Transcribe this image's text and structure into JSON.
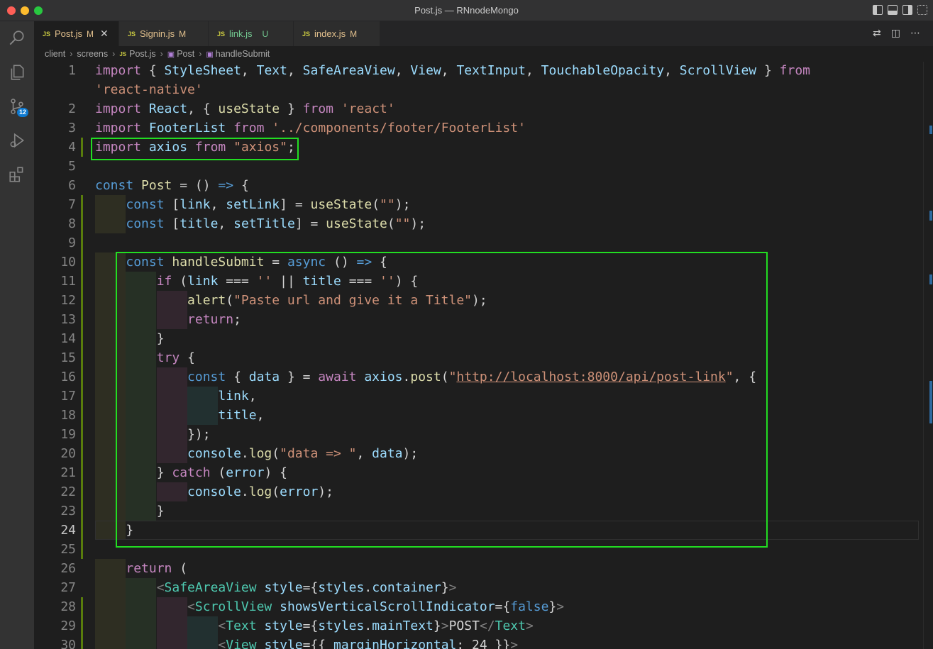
{
  "window": {
    "title": "Post.js — RNnodeMongo"
  },
  "activity_bar": {
    "items": [
      {
        "name": "explorer",
        "icon": "files-icon"
      },
      {
        "name": "search",
        "icon": "search-icon"
      },
      {
        "name": "source-control",
        "icon": "source-control-icon",
        "badge": "12"
      },
      {
        "name": "run-debug",
        "icon": "run-debug-icon"
      },
      {
        "name": "extensions",
        "icon": "extensions-icon"
      }
    ]
  },
  "tabs": [
    {
      "label": "Post.js",
      "status": "M",
      "active": true
    },
    {
      "label": "Signin.js",
      "status": "M",
      "active": false
    },
    {
      "label": "link.js",
      "status": "U",
      "active": false
    },
    {
      "label": "index.js",
      "status": "M",
      "active": false
    }
  ],
  "tab_file_type": "JS",
  "breadcrumb": [
    "client",
    "screens",
    "Post.js",
    "Post",
    "handleSubmit"
  ],
  "editor": {
    "current_line": 24,
    "lines": [
      {
        "n": "1",
        "t": "import { StyleSheet, Text, SafeAreaView, View, TextInput, TouchableOpacity, ScrollView } from"
      },
      {
        "n": "",
        "t": "'react-native'"
      },
      {
        "n": "2",
        "t": "import React, { useState } from 'react'"
      },
      {
        "n": "3",
        "t": "import FooterList from '../components/footer/FooterList'"
      },
      {
        "n": "4",
        "t": "import axios from \"axios\";"
      },
      {
        "n": "5",
        "t": ""
      },
      {
        "n": "6",
        "t": "const Post = () => {"
      },
      {
        "n": "7",
        "t": "    const [link, setLink] = useState(\"\");"
      },
      {
        "n": "8",
        "t": "    const [title, setTitle] = useState(\"\");"
      },
      {
        "n": "9",
        "t": ""
      },
      {
        "n": "10",
        "t": "    const handleSubmit = async () => {"
      },
      {
        "n": "11",
        "t": "        if (link === '' || title === '') {"
      },
      {
        "n": "12",
        "t": "            alert(\"Paste url and give it a Title\");"
      },
      {
        "n": "13",
        "t": "            return;"
      },
      {
        "n": "14",
        "t": "        }"
      },
      {
        "n": "15",
        "t": "        try {"
      },
      {
        "n": "16",
        "t": "            const { data } = await axios.post(\"http://localhost:8000/api/post-link\", {"
      },
      {
        "n": "17",
        "t": "                link,"
      },
      {
        "n": "18",
        "t": "                title,"
      },
      {
        "n": "19",
        "t": "            });"
      },
      {
        "n": "20",
        "t": "            console.log(\"data => \", data);"
      },
      {
        "n": "21",
        "t": "        } catch (error) {"
      },
      {
        "n": "22",
        "t": "            console.log(error);"
      },
      {
        "n": "23",
        "t": "        }"
      },
      {
        "n": "24",
        "t": "    }"
      },
      {
        "n": "25",
        "t": ""
      },
      {
        "n": "26",
        "t": "    return ("
      },
      {
        "n": "27",
        "t": "        <SafeAreaView style={styles.container}>"
      },
      {
        "n": "28",
        "t": "            <ScrollView showsVerticalScrollIndicator={false}>"
      },
      {
        "n": "29",
        "t": "                <Text style={styles.mainText}>POST</Text>"
      },
      {
        "n": "30",
        "t": "                <View style={{ marginHorizontal: 24 }}>"
      }
    ]
  }
}
